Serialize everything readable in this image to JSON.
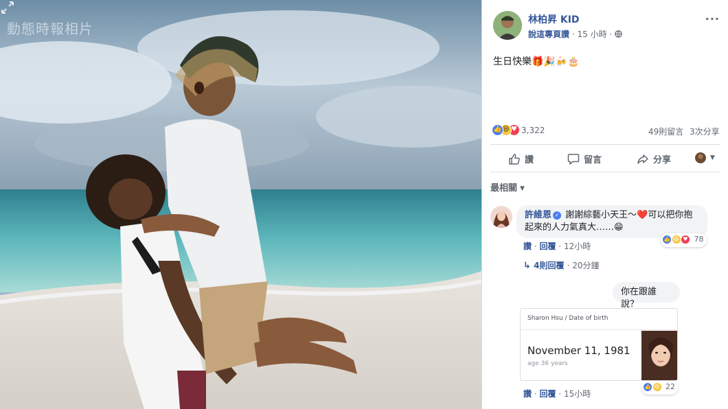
{
  "photo": {
    "watermark": "動態時報相片"
  },
  "post": {
    "author": "林柏昇 KID",
    "subtitle": "說這專頁讚",
    "time": "15 小時",
    "text": "生日快樂🎁🎉🍻🎂",
    "reaction_count": "3,322",
    "comments_count": "49則留言",
    "shares_count": "3次分享",
    "actions": {
      "like": "讚",
      "comment": "留言",
      "share": "分享"
    },
    "sort_label": "最相關"
  },
  "comments": [
    {
      "author": "許維恩",
      "text": "謝謝綜藝小天王～❤️可以把你抱起來的人力氣真大……😁",
      "like_label": "讚",
      "reply_label": "回覆",
      "time": "12小時",
      "reactions": "78",
      "replies_link": "4則回覆",
      "replies_time": "20分鐘"
    },
    {
      "text": "你在跟誰說？"
    },
    {
      "card": {
        "header": "Sharon Hsu / Date of birth",
        "date": "November 11, 1981",
        "age": "age 36 years"
      },
      "like_label": "讚",
      "reply_label": "回覆",
      "time": "15小時",
      "reactions": "22"
    }
  ],
  "colors": {
    "link": "#365899",
    "like": "#4a7ef0",
    "love": "#f03e55",
    "haha": "#f7c53d"
  }
}
